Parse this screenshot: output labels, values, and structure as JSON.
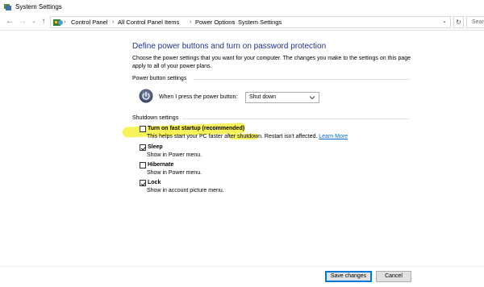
{
  "window": {
    "title": "System Settings"
  },
  "addressbar": {
    "breadcrumbs": [
      "Control Panel",
      "All Control Panel Items",
      "Power Options",
      "System Settings"
    ],
    "search_placeholder": "Sear",
    "icons": [
      "back-arrow-icon",
      "forward-arrow-icon",
      "dropdown-chevron-icon",
      "up-arrow-icon",
      "control-panel-icon",
      "refresh-icon"
    ]
  },
  "main": {
    "heading": "Define power buttons and turn on password protection",
    "description": "Choose the power settings that you want for your computer. The changes you make to the settings on this page apply to all of your power plans.",
    "power_section": {
      "label": "Power button settings",
      "power_button_label": "When I press the power button:",
      "power_button_value": "Shut down"
    },
    "shutdown_section": {
      "label": "Shutdown settings",
      "options": [
        {
          "title": "Turn on fast startup (recommended)",
          "description": "This helps start your PC faster after shutdown. Restart isn't affected.",
          "link": "Learn More",
          "checked": false
        },
        {
          "title": "Sleep",
          "description": "Show in Power menu.",
          "checked": true
        },
        {
          "title": "Hibernate",
          "description": "Show in Power menu.",
          "checked": false
        },
        {
          "title": "Lock",
          "description": "Show in account picture menu.",
          "checked": true
        }
      ]
    }
  },
  "footer": {
    "save_label": "Save changes",
    "cancel_label": "Cancel"
  },
  "colors": {
    "heading": "#1e3287",
    "link": "#0066cc",
    "highlight": "#f8f35a",
    "primary_border": "#0078d7"
  }
}
